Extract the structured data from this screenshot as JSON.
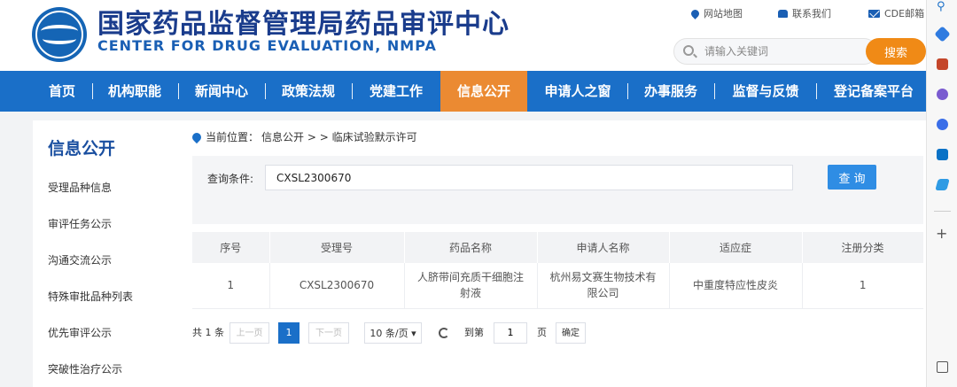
{
  "header": {
    "title_cn": "国家药品监督管理局药品审评中心",
    "title_en": "CENTER FOR DRUG EVALUATION, NMPA",
    "links": [
      {
        "label": "网站地图",
        "icon": "map-pin-icon"
      },
      {
        "label": "联系我们",
        "icon": "phone-icon"
      },
      {
        "label": "CDE邮箱",
        "icon": "mail-icon"
      }
    ],
    "search_placeholder": "请输入关键词",
    "search_button": "搜索"
  },
  "nav": {
    "items": [
      "首页",
      "机构职能",
      "新闻中心",
      "政策法规",
      "党建工作",
      "信息公开",
      "申请人之窗",
      "办事服务",
      "监督与反馈",
      "登记备案平台"
    ],
    "active": "信息公开"
  },
  "sidebar": {
    "title": "信息公开",
    "items": [
      "受理品种信息",
      "审评任务公示",
      "沟通交流公示",
      "特殊审批品种列表",
      "优先审评公示",
      "突破性治疗公示"
    ]
  },
  "breadcrumb": {
    "prefix": "当前位置：",
    "path": "信息公开 > > 临床试验默示许可"
  },
  "query": {
    "label": "查询条件:",
    "value": "CXSL2300670",
    "button": "查 询"
  },
  "table": {
    "headers": [
      "序号",
      "受理号",
      "药品名称",
      "申请人名称",
      "适应症",
      "注册分类"
    ],
    "rows": [
      [
        "1",
        "CXSL2300670",
        "人脐带间充质干细胞注射液",
        "杭州易文赛生物技术有限公司",
        "中重度特应性皮炎",
        "1"
      ]
    ]
  },
  "pagination": {
    "total": "共 1 条",
    "prev": "上一页",
    "current_page": "1",
    "next": "下一页",
    "page_size": "10 条/页",
    "goto_label": "到第",
    "goto_value": "1",
    "page_unit": "页",
    "confirm": "确定"
  },
  "colors": {
    "nav_bg": "#1a6fc8",
    "nav_active": "#eb8a32",
    "search_button": "#f08a16",
    "title": "#1a3c8c",
    "query_button": "#2f8de4"
  }
}
